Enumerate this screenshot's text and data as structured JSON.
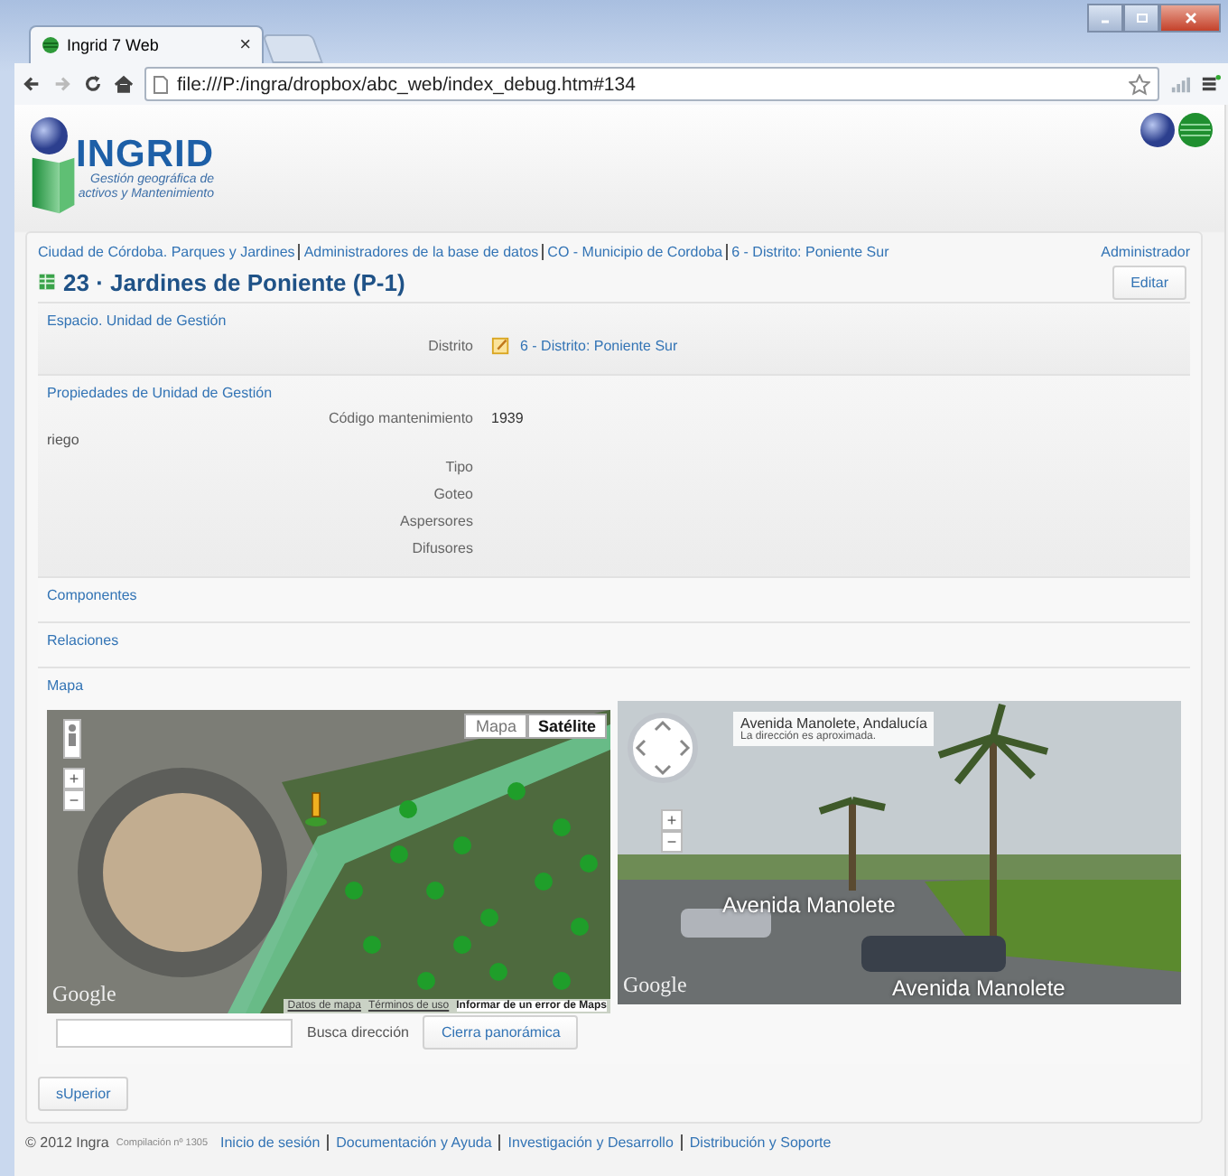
{
  "browser": {
    "tab_title": "Ingrid 7 Web",
    "tab_close": "×",
    "url": "file:///P:/ingra/dropbox/abc_web/index_debug.htm#134"
  },
  "header": {
    "logo_text": "INGRID",
    "logo_subtitle": [
      "Gestión geográfica de",
      "activos y Mantenimiento"
    ]
  },
  "breadcrumbs": [
    "Ciudad de Córdoba. Parques y Jardines",
    "Administradores de la base de datos",
    "CO - Municipio de Cordoba",
    "6 - Distrito: Poniente Sur"
  ],
  "user": "Administrador",
  "title": "23 · Jardines de Poniente (P-1)",
  "edit_button": "Editar",
  "sections": [
    {
      "kind": "fields",
      "title": "Espacio. Unidad de Gestión",
      "rows": [
        {
          "kind": "link",
          "label": "Distrito",
          "value": "6 - Distrito: Poniente Sur"
        }
      ]
    },
    {
      "kind": "fields",
      "title": "Propiedades de Unidad de Gestión",
      "rows": [
        {
          "kind": "text",
          "label": "Código mantenimiento",
          "value": "1939"
        },
        {
          "kind": "group",
          "label": "riego"
        },
        {
          "kind": "text",
          "label": "Tipo"
        },
        {
          "kind": "text",
          "label": "Goteo"
        },
        {
          "kind": "text",
          "label": "Aspersores"
        },
        {
          "kind": "text",
          "label": "Difusores"
        }
      ]
    },
    {
      "kind": "collapsed",
      "title": "Componentes"
    },
    {
      "kind": "collapsed",
      "title": "Relaciones"
    },
    {
      "kind": "map",
      "title": "Mapa"
    }
  ],
  "map": {
    "type_buttons": [
      {
        "label": "Mapa",
        "selected": false
      },
      {
        "label": "Satélite",
        "selected": true
      }
    ],
    "zoom_in": "+",
    "zoom_out": "−",
    "logo": "Google",
    "attribution": [
      "Datos de mapa",
      "Términos de uso"
    ],
    "report": "Informar de un error de Maps"
  },
  "street_view": {
    "address": "Avenida Manolete, Andalucía",
    "note": "La dirección es aproximada.",
    "zoom_in": "+",
    "zoom_out": "−",
    "street_labels": [
      "Avenida Manolete",
      "Avenida Manolete"
    ],
    "logo": "Google"
  },
  "address_search": {
    "label": "Busca dirección",
    "button": "Cierra panorámica"
  },
  "top_button": "sUperior",
  "footer": {
    "copyright": "© 2012 Ingra",
    "build": "Compilación nº 1305",
    "links": [
      "Inicio de sesión",
      "Documentación y Ayuda",
      "Investigación y Desarrollo",
      "Distribución y Soporte"
    ]
  }
}
